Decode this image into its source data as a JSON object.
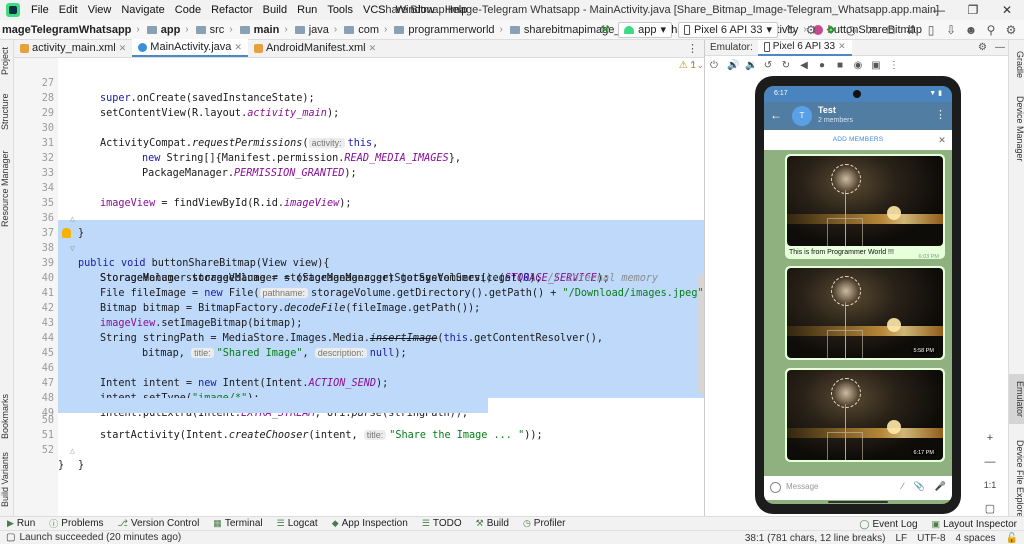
{
  "menu": {
    "items": [
      "File",
      "Edit",
      "View",
      "Navigate",
      "Code",
      "Refactor",
      "Build",
      "Run",
      "Tools",
      "VCS",
      "Window",
      "Help"
    ],
    "window_title": "Share Bitmap Image-Telegram Whatsapp - MainActivity.java [Share_Bitmap_Image-Telegram_Whatsapp.app.main]"
  },
  "breadcrumb": {
    "project": "mageTelegramWhatsapp",
    "parts": [
      "app",
      "src",
      "main",
      "java",
      "com",
      "programmerworld",
      "sharebitmapimage_telegramwhatsapp",
      "MainActivity",
      "buttonShareBitmap"
    ]
  },
  "run_config": {
    "module": "app",
    "device": "Pixel 6 API 33"
  },
  "left_tools": [
    "Project",
    "Structure",
    "Resource Manager",
    "Bookmarks",
    "Build Variants"
  ],
  "editor_tabs": [
    {
      "label": "activity_main.xml",
      "kind": "xml",
      "active": false
    },
    {
      "label": "MainActivity.java",
      "kind": "java",
      "active": true
    },
    {
      "label": "AndroidManifest.xml",
      "kind": "xml",
      "active": false
    }
  ],
  "editor": {
    "warnings": "1",
    "line_numbers": [
      "27",
      "28",
      "29",
      "30",
      "31",
      "32",
      "33",
      "34",
      "35",
      "36",
      "37",
      "38",
      "39",
      "40",
      "41",
      "42",
      "43",
      "44",
      "45",
      "46",
      "47",
      "48",
      "49",
      "50",
      "51",
      "52"
    ]
  },
  "code": {
    "l27a": "super",
    "l27b": ".onCreate(savedInstanceState);",
    "l28": "setContentView(R.layout.",
    "l28f": "activity_main",
    "l28e": ");",
    "l30a": "ActivityCompat.",
    "l30m": "requestPermissions",
    "l30b": "(",
    "l30h": "activity:",
    "l30k": "this",
    "l30c": ",",
    "l31k": "new",
    "l31a": " String[]{Manifest.permission.",
    "l31f": "READ_MEDIA_IMAGES",
    "l31b": "},",
    "l32a": "PackageManager.",
    "l32f": "PERMISSION_GRANTED",
    "l32b": ");",
    "l34f": "imageView",
    "l34a": " = findViewById(R.id.",
    "l34g": "imageView",
    "l34b": ");",
    "l35": "}",
    "l37k1": "public",
    "l37k2": "void",
    "l37a": " buttonShareBitmap(View view){",
    "l38a": "StorageManager storageManager = (StorageManager) getSystemService(",
    "l38f": "STORAGE_SERVICE",
    "l38b": ");",
    "l39a": "StorageVolume storageVolume = storageManager.getStorageVolumes().get(",
    "l39n": "0",
    "l39b": "); ",
    "l39c": "// internal memory",
    "l40a": "File fileImage = ",
    "l40k": "new",
    "l40b": " File(",
    "l40h": "pathname:",
    "l40c": "storageVolume.getDirectory().getPath() + ",
    "l40s": "\"/Download/images.jpeg\"",
    "l40d": ");",
    "l41a": "Bitmap bitmap = BitmapFactory.",
    "l41m": "decodeFile",
    "l41b": "(fileImage.getPath());",
    "l42f": "imageView",
    "l42a": ".setImageBitmap(bitmap);",
    "l43a": "String stringPath = MediaStore.Images.Media.",
    "l43m": "insertImage",
    "l43b": "(",
    "l43k": "this",
    "l43c": ".getContentResolver(),",
    "l44a": "bitmap, ",
    "l44h1": "title:",
    "l44s": "\"Shared Image\"",
    "l44b": ", ",
    "l44h2": "description:",
    "l44k": "null",
    "l44c": ");",
    "l46a": "Intent intent = ",
    "l46k": "new",
    "l46b": " Intent(Intent.",
    "l46f": "ACTION_SEND",
    "l46c": ");",
    "l47a": "intent.setType(",
    "l47s": "\"image/*\"",
    "l47b": ");",
    "l48a": "intent.putExtra(Intent.",
    "l48f": "EXTRA_STREAM",
    "l48b": ", Uri.",
    "l48m": "parse",
    "l48c": "(stringPath));",
    "l50a": "startActivity(Intent.",
    "l50m": "createChooser",
    "l50b": "(intent, ",
    "l50h": "title:",
    "l50s": "\"Share the Image ... \"",
    "l50c": "));",
    "l51": "}",
    "l52": "}"
  },
  "emulator": {
    "label": "Emulator:",
    "tab": "Pixel 6 API 33",
    "zoom_ratio": "1:1",
    "phone": {
      "time": "6:17",
      "chat_name": "Test",
      "chat_members": "2 members",
      "avatar_letter": "T",
      "add_members": "ADD MEMBERS",
      "caption": "This is from Programmer World !!!",
      "times": [
        "6:03 PM",
        "5:58 PM",
        "6:17 PM"
      ],
      "input_placeholder": "Message"
    }
  },
  "right_tools": [
    "Gradle",
    "Device Manager",
    "Emulator",
    "Device File Explorer"
  ],
  "bottom_tools": [
    "Run",
    "Problems",
    "Version Control",
    "Terminal",
    "Logcat",
    "App Inspection",
    "TODO",
    "Build",
    "Profiler"
  ],
  "bottom_right_tools": [
    "Event Log",
    "Layout Inspector"
  ],
  "status": {
    "message": "Launch succeeded (20 minutes ago)",
    "position": "38:1 (781 chars, 12 line breaks)",
    "line_sep": "LF",
    "encoding": "UTF-8",
    "indent": "4 spaces"
  }
}
